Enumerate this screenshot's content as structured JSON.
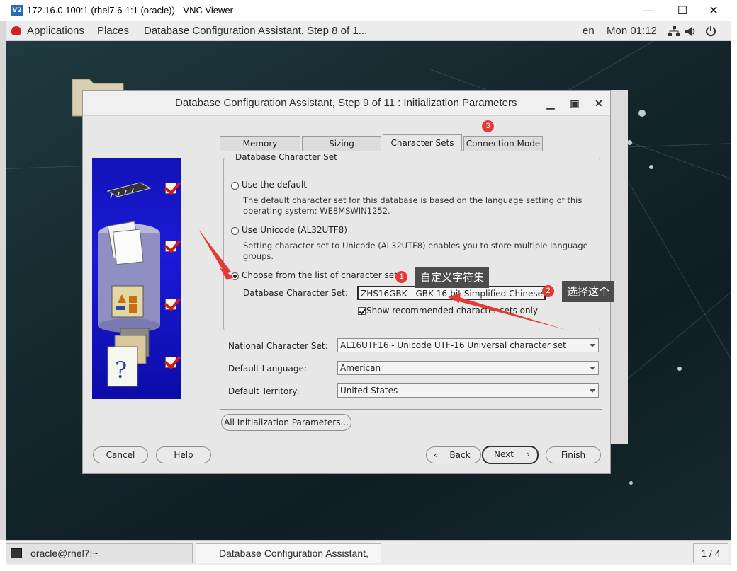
{
  "vnc": {
    "icon_text": "V2",
    "title": "172.16.0.100:1 (rhel7.6-1:1 (oracle)) - VNC Viewer",
    "minimize": "—",
    "maximize": "☐",
    "close": "✕"
  },
  "topbar": {
    "applications": "Applications",
    "places": "Places",
    "window_title": "Database Configuration Assistant, Step 8 of 1...",
    "lang": "en",
    "clock": "Mon 01:12"
  },
  "dialog": {
    "title": "Database Configuration Assistant, Step 9 of 11 : Initialization Parameters",
    "controls": {
      "minimize": "▁",
      "maximize": "▣",
      "close": "✕"
    },
    "tabs": [
      "Memory",
      "Sizing",
      "Character Sets",
      "Connection Mode"
    ],
    "active_tab": "Character Sets",
    "group_title": "Database Character Set",
    "options": {
      "default_label": "Use the default",
      "default_desc": "The default character set for this database is based on the language setting of this operating system: WE8MSWIN1252.",
      "unicode_label": "Use Unicode (AL32UTF8)",
      "unicode_desc": "Setting character set to Unicode (AL32UTF8) enables you to store multiple language groups.",
      "list_label": "Choose from the list of character sets",
      "selected": "list"
    },
    "db_charset_label": "Database Character Set:",
    "db_charset_value": "ZHS16GBK - GBK 16-bit Simplified Chinese",
    "show_recommended": "Show recommended character sets only",
    "show_recommended_checked": true,
    "national_label": "National Character Set:",
    "national_value": "AL16UTF16 - Unicode UTF-16 Universal character set",
    "language_label": "Default Language:",
    "language_value": "American",
    "territory_label": "Default Territory:",
    "territory_value": "United States",
    "all_params_button": "All Initialization Parameters...",
    "buttons": {
      "cancel": "Cancel",
      "help": "Help",
      "back": "Back",
      "next": "Next",
      "finish": "Finish"
    },
    "step_checks": 4
  },
  "annotations": {
    "badge1": "1",
    "callout1": "自定义字符集",
    "badge2": "2",
    "callout2": "选择这个",
    "badge3": "3",
    "arrow_color": "#e53935"
  },
  "taskbar": {
    "terminal": "oracle@rhel7:~",
    "dbca": "Database Configuration Assistant, St...",
    "pager": "1 / 4"
  },
  "colors": {
    "desktop": "#15272c",
    "side_panel": "#1616c8",
    "badge": "#e53935",
    "callout": "#4c4c4c"
  }
}
